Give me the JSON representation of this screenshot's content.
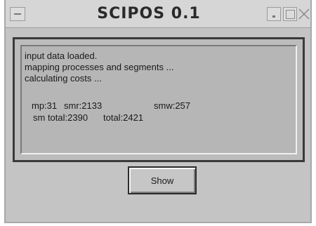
{
  "window": {
    "title": "SCIPOS 0.1"
  },
  "log": {
    "lines": [
      "input data loaded.",
      "mapping processes and segments ...",
      "calculating costs ..."
    ],
    "stats": {
      "mp": "mp:31",
      "smr": "smr:2133",
      "smw": "smw:257",
      "sm_total": "sm total:2390",
      "total": "total:2421"
    }
  },
  "buttons": {
    "show_label": "Show"
  },
  "icons": {
    "window_menu": "window-menu-icon",
    "minimize": "minimize-icon",
    "maximize": "maximize-icon",
    "close": "close-icon"
  }
}
